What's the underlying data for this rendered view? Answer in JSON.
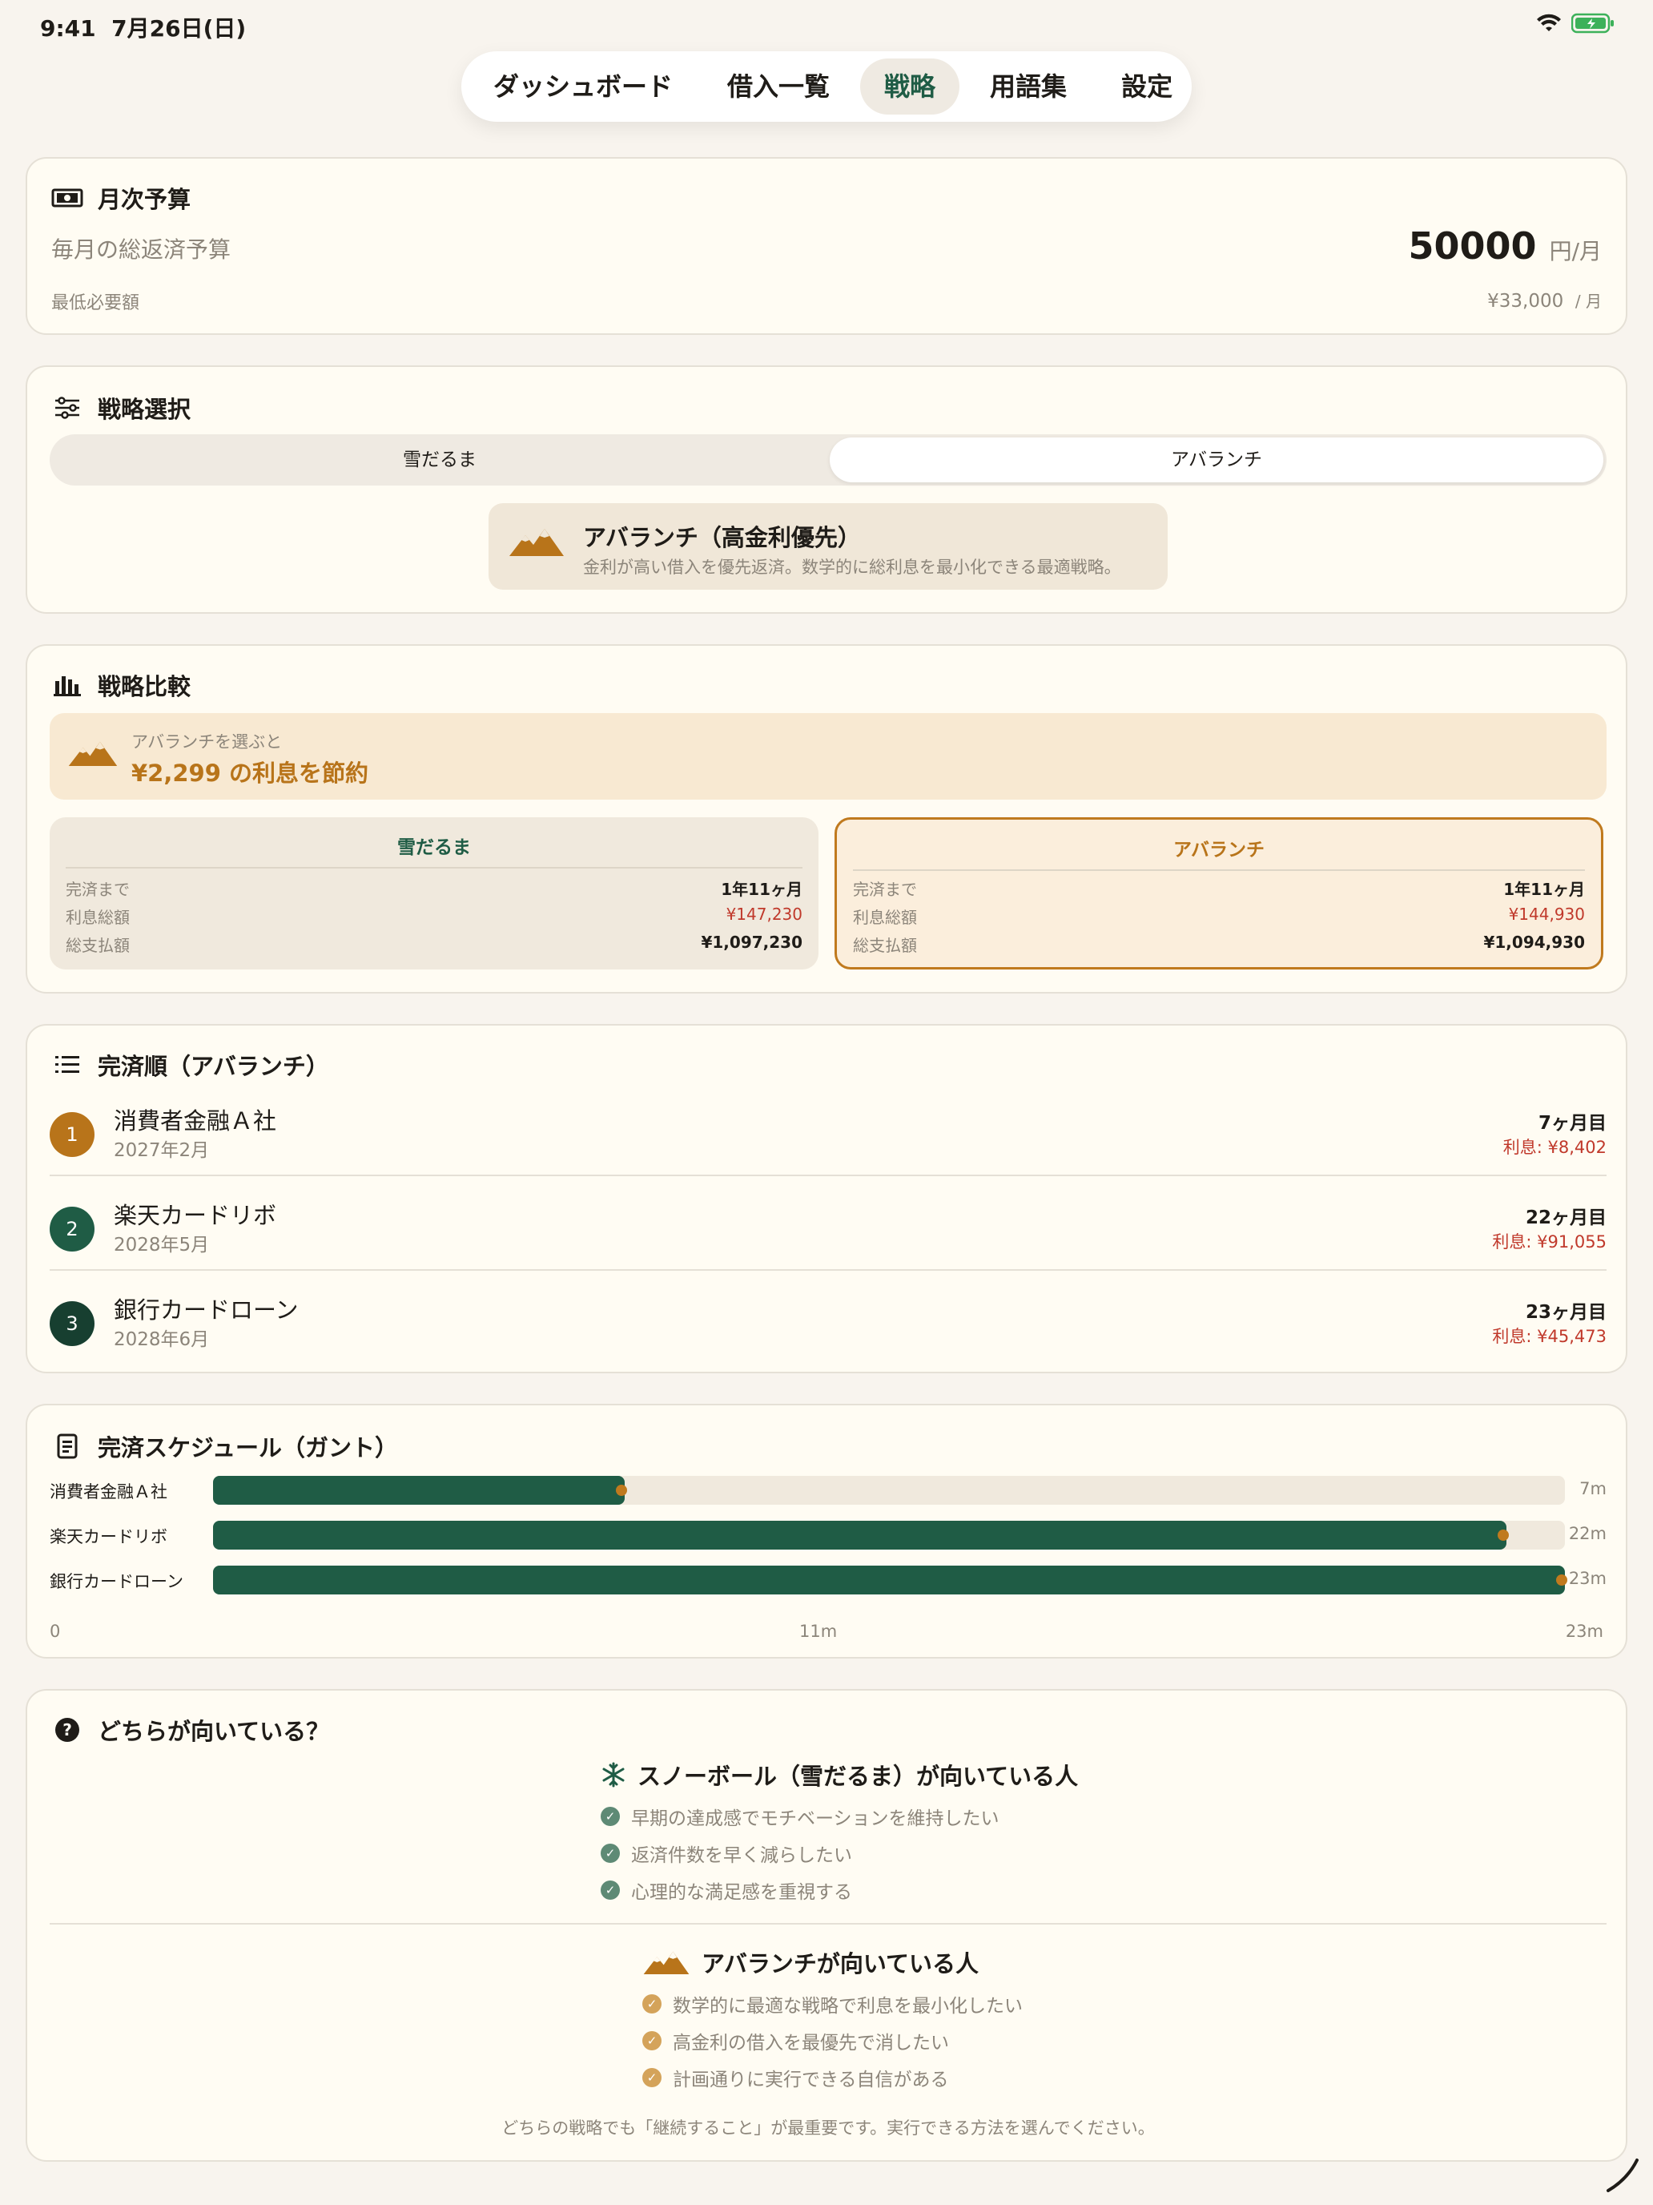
{
  "status": {
    "time": "9:41",
    "date": "7月26日(日)"
  },
  "tabs": [
    "ダッシュボード",
    "借入一覧",
    "戦略",
    "用語集",
    "設定"
  ],
  "active_tab": "戦略",
  "budget": {
    "title": "月次予算",
    "label": "毎月の総返済予算",
    "value": "50000",
    "unit": "円/月",
    "min_label": "最低必要額",
    "min_value": "¥33,000",
    "min_unit": "/ 月"
  },
  "strategy": {
    "title": "戦略選択",
    "options": [
      "雪だるま",
      "アバランチ"
    ],
    "selected": "アバランチ",
    "info_title": "アバランチ（高金利優先）",
    "info_desc": "金利が高い借入を優先返済。数学的に総利息を最小化できる最適戦略。"
  },
  "compare": {
    "title": "戦略比較",
    "save_caption": "アバランチを選ぶと",
    "save_text": "¥2,299 の利息を節約",
    "snow": {
      "name": "雪だるま",
      "k1": "完済まで",
      "v1": "1年11ヶ月",
      "k2": "利息総額",
      "v2": "¥147,230",
      "k3": "総支払額",
      "v3": "¥1,097,230"
    },
    "ava": {
      "name": "アバランチ",
      "k1": "完済まで",
      "v1": "1年11ヶ月",
      "k2": "利息総額",
      "v2": "¥144,930",
      "k3": "総支払額",
      "v3": "¥1,094,930"
    }
  },
  "order": {
    "title": "完済順（アバランチ）",
    "items": [
      {
        "num": "1",
        "name": "消費者金融Ａ社",
        "date": "2027年2月",
        "month": "7ヶ月目",
        "interest": "利息: ¥8,402",
        "color": "#B8741A"
      },
      {
        "num": "2",
        "name": "楽天カードリボ",
        "date": "2028年5月",
        "month": "22ヶ月目",
        "interest": "利息: ¥91,055",
        "color": "#1F5C45"
      },
      {
        "num": "3",
        "name": "銀行カードローン",
        "date": "2028年6月",
        "month": "23ヶ月目",
        "interest": "利息: ¥45,473",
        "color": "#173F30"
      }
    ]
  },
  "gantt": {
    "title": "完済スケジュール（ガント）",
    "max_months": 23,
    "rows": [
      {
        "label": "消費者金融Ａ社",
        "months": 7,
        "end_label": "7m"
      },
      {
        "label": "楽天カードリボ",
        "months": 22,
        "end_label": "22m"
      },
      {
        "label": "銀行カードローン",
        "months": 23,
        "end_label": "23m"
      }
    ],
    "axis": [
      "0",
      "11m",
      "23m"
    ]
  },
  "which": {
    "title": "どちらが向いている？",
    "snow_title": "スノーボール（雪だるま）が向いている人",
    "snow_items": [
      "早期の達成感でモチベーションを維持したい",
      "返済件数を早く減らしたい",
      "心理的な満足感を重視する"
    ],
    "ava_title": "アバランチが向いている人",
    "ava_items": [
      "数学的に最適な戦略で利息を最小化したい",
      "高金利の借入を最優先で消したい",
      "計画通りに実行できる自信がある"
    ],
    "note": "どちらの戦略でも「継続すること」が最重要です。実行できる方法を選んでください。"
  },
  "colors": {
    "accent_green": "#1F5C45",
    "accent_gold": "#B8741A",
    "danger": "#C0392B",
    "background": "#F8F4EE"
  }
}
